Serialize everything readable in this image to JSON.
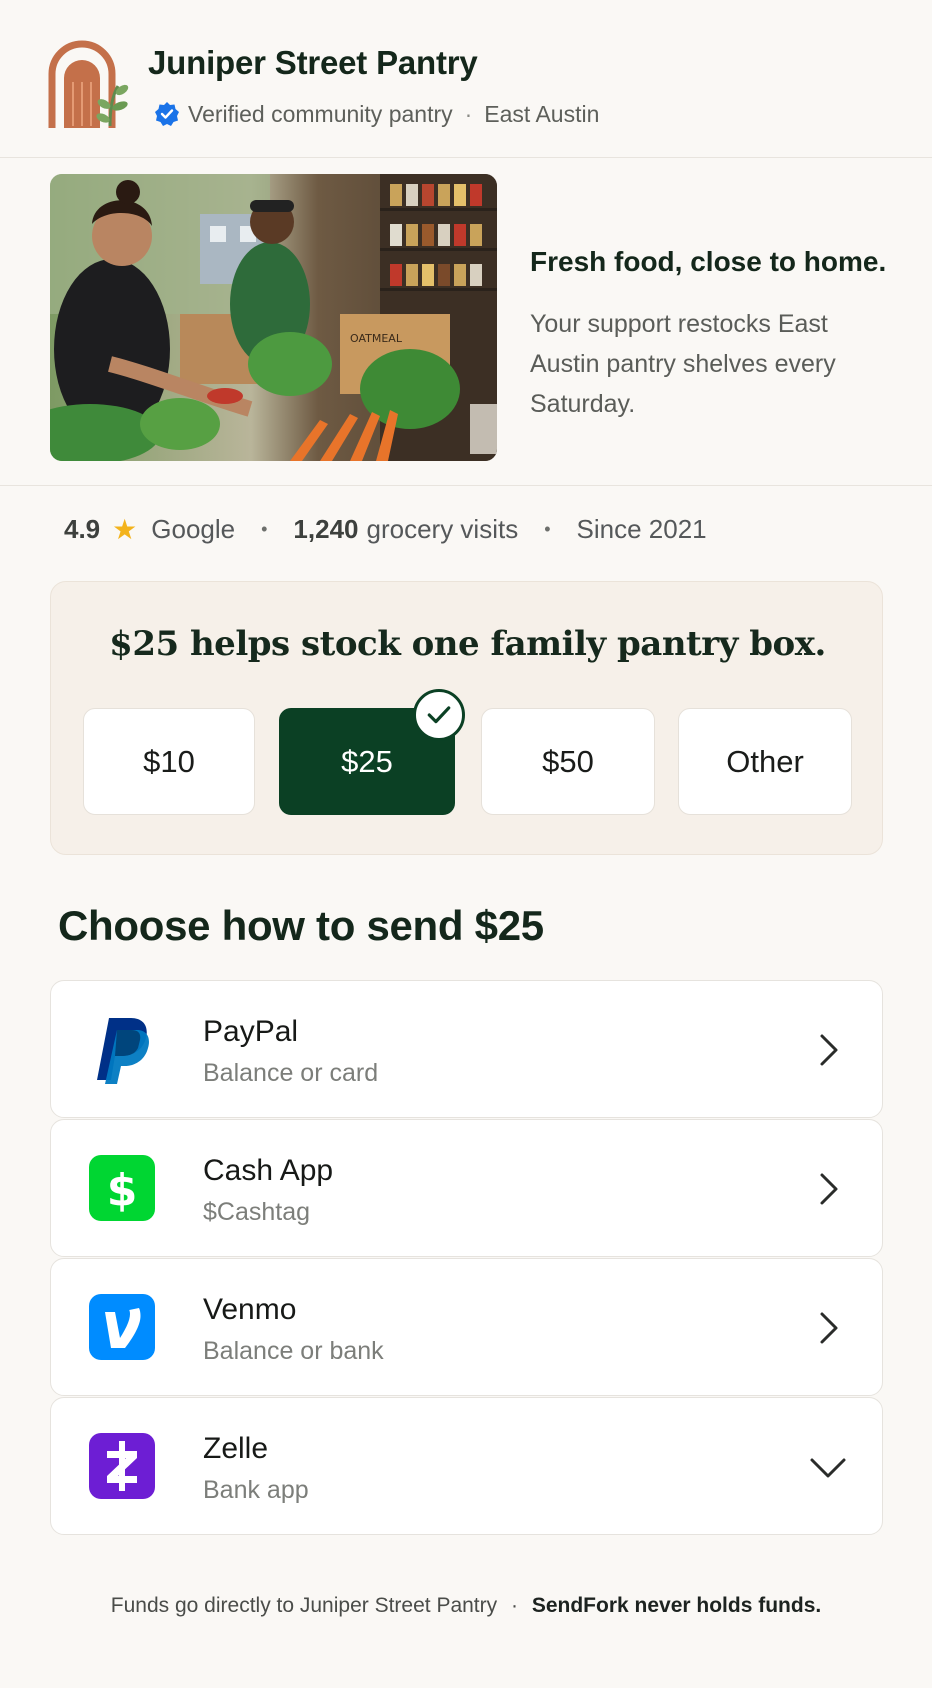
{
  "header": {
    "org_name": "Juniper Street Pantry",
    "verified_text": "Verified community pantry",
    "location": "East Austin"
  },
  "hero": {
    "title": "Fresh food, close to home.",
    "body": "Your support restocks East Austin pantry shelves every Saturday.",
    "photo_box_text": "OATMEAL"
  },
  "stats": {
    "rating": "4.9",
    "rating_source": "Google",
    "visits_count": "1,240",
    "visits_label": "grocery visits",
    "since": "Since 2021"
  },
  "amounts": {
    "headline": "$25 helps stock one family pantry box.",
    "options": [
      "$10",
      "$25",
      "$50",
      "Other"
    ],
    "selected": "$25"
  },
  "send": {
    "heading": "Choose how to send $25",
    "methods": [
      {
        "name": "PayPal",
        "sub": "Balance or card",
        "icon": "paypal-icon",
        "expand": "chevron-right-icon"
      },
      {
        "name": "Cash App",
        "sub": "$Cashtag",
        "icon": "cashapp-icon",
        "expand": "chevron-right-icon"
      },
      {
        "name": "Venmo",
        "sub": "Balance or bank",
        "icon": "venmo-icon",
        "expand": "chevron-right-icon"
      },
      {
        "name": "Zelle",
        "sub": "Bank app",
        "icon": "zelle-icon",
        "expand": "chevron-down-icon"
      }
    ]
  },
  "footer": {
    "direct": "Funds go directly to Juniper Street Pantry",
    "never_holds": "SendFork never holds funds."
  },
  "colors": {
    "brand_green": "#0b4024",
    "logo_terracotta": "#c4704a",
    "paypal": "#003087",
    "cashapp": "#00d632",
    "venmo": "#008cff",
    "zelle": "#6d1ed4",
    "verified_blue": "#1a73e8",
    "star": "#f3b31c"
  }
}
